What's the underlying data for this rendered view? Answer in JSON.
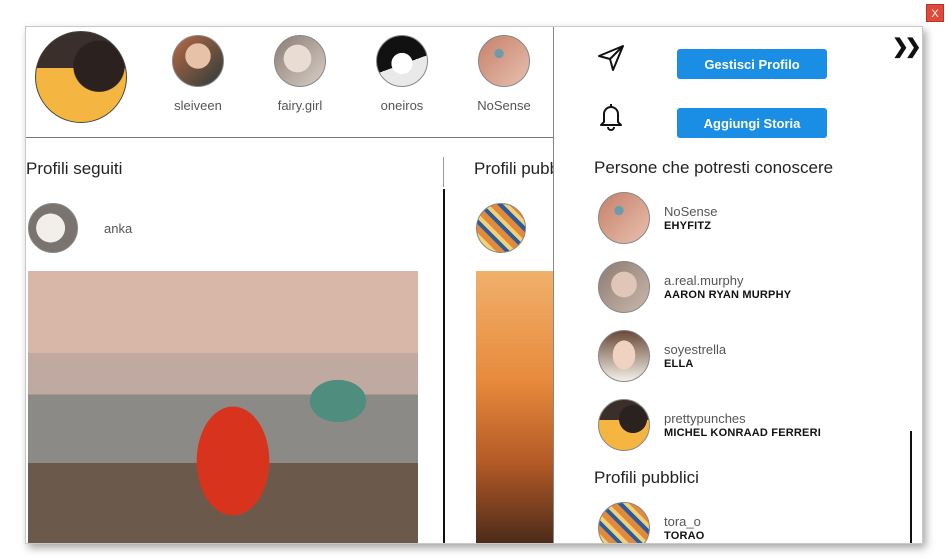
{
  "window": {
    "close_label": "X"
  },
  "stories": {
    "items": [
      {
        "handle": "sleiveen",
        "color": "#b86a46"
      },
      {
        "handle": "fairy.girl",
        "color": "#c9b9b0"
      },
      {
        "handle": "oneiros",
        "color": "#303030"
      },
      {
        "handle": "NoSense",
        "color": "#d49a86"
      }
    ]
  },
  "feed": {
    "followed_title": "Profili seguiti",
    "public_title": "Profili pubb",
    "followed_post_user": "anka"
  },
  "panel": {
    "manage_profile_label": "Gestisci Profilo",
    "add_story_label": "Aggiungi Storia",
    "suggestions_title": "Persone che potresti conoscere",
    "suggestions": [
      {
        "handle": "NoSense",
        "name": "EHYFITZ",
        "color": "#d49a86"
      },
      {
        "handle": "a.real.murphy",
        "name": "AARON RYAN MURPHY",
        "color": "#b8a49a"
      },
      {
        "handle": "soyestrella",
        "name": "ELLA",
        "color": "#c6a08a"
      },
      {
        "handle": "prettypunches",
        "name": "MICHEL KONRAAD FERRERI",
        "color": "#f4b640"
      }
    ],
    "public_title": "Profili pubblici",
    "public_profiles": [
      {
        "handle": "tora_o",
        "name": "TORAO",
        "color": "#e28a3a"
      }
    ]
  }
}
